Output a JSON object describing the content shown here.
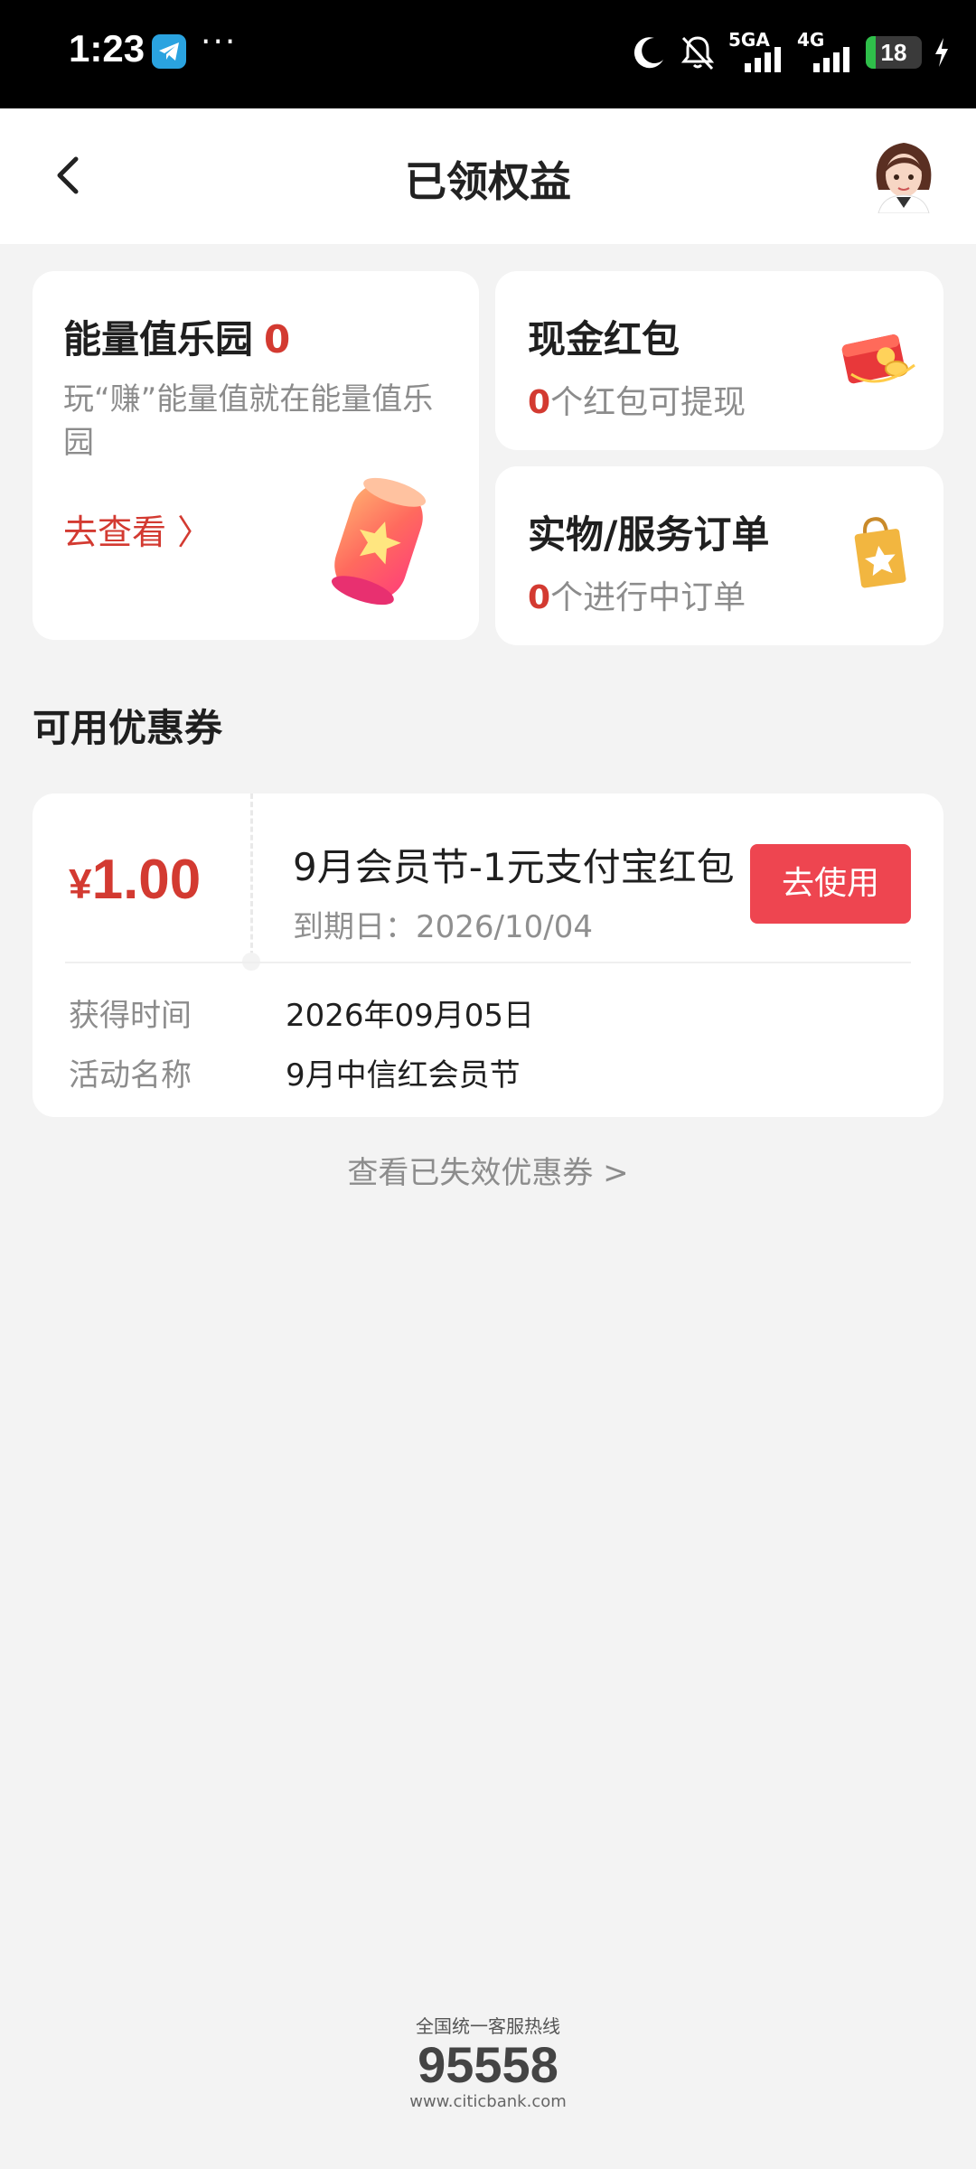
{
  "status_bar": {
    "time": "1:23",
    "dots": "···",
    "net1": "5GA",
    "net2": "4G",
    "battery": "18",
    "battery_level": 0.18
  },
  "header": {
    "title": "已领权益"
  },
  "energy_card": {
    "title": "能量值乐园",
    "count": "0",
    "desc": "玩“赚”能量值就在能量值乐园",
    "link": "去查看 〉"
  },
  "cash_card": {
    "title": "现金红包",
    "count": "0",
    "suffix": "个红包可提现"
  },
  "orders_card": {
    "title": "实物/服务订单",
    "count": "0",
    "suffix": "个进行中订单"
  },
  "section_title": "可用优惠券",
  "coupon": {
    "currency": "¥",
    "amount": "1.00",
    "name": "9月会员节-1元支付宝红包",
    "expiry": "到期日：2026/10/04",
    "use_button": "去使用",
    "fields": [
      {
        "label": "获得时间",
        "value": "2026年09月05日"
      },
      {
        "label": "活动名称",
        "value": "9月中信红会员节"
      }
    ]
  },
  "expired_link": "查看已失效优惠券 >",
  "footer": {
    "caption": "全国统一客服热线",
    "number": "95558",
    "url": "www.citicbank.com"
  },
  "colors": {
    "accent_red": "#d33a31",
    "button_red": "#ee4550"
  }
}
